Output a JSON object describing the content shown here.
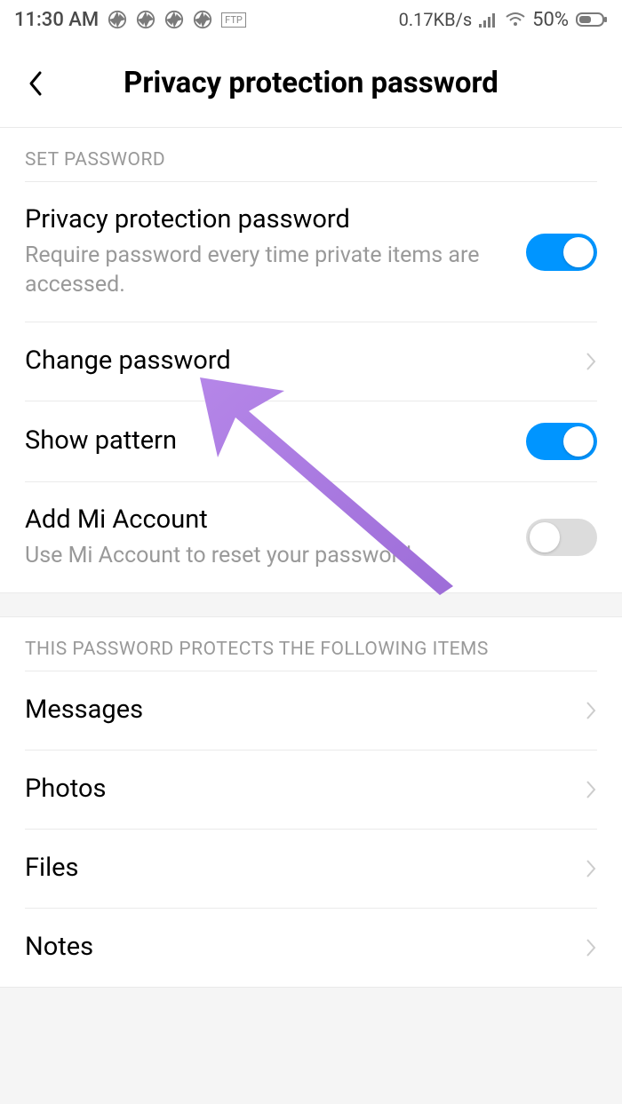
{
  "status_bar": {
    "time": "11:30 AM",
    "data_rate": "0.17KB/s",
    "battery_pct": "50%",
    "ftp_label": "FTP"
  },
  "header": {
    "title": "Privacy protection password"
  },
  "sections": {
    "set_password": {
      "header": "SET PASSWORD",
      "privacy_toggle": {
        "title": "Privacy protection password",
        "subtitle": "Require password every time private items are accessed.",
        "value": true
      },
      "change_password": {
        "title": "Change password"
      },
      "show_pattern": {
        "title": "Show pattern",
        "value": true
      },
      "add_mi_account": {
        "title": "Add Mi Account",
        "subtitle": "Use Mi Account to reset your password",
        "value": false
      }
    },
    "protected_items": {
      "header": "THIS PASSWORD PROTECTS THE FOLLOWING ITEMS",
      "items": [
        {
          "label": "Messages"
        },
        {
          "label": "Photos"
        },
        {
          "label": "Files"
        },
        {
          "label": "Notes"
        }
      ]
    }
  }
}
